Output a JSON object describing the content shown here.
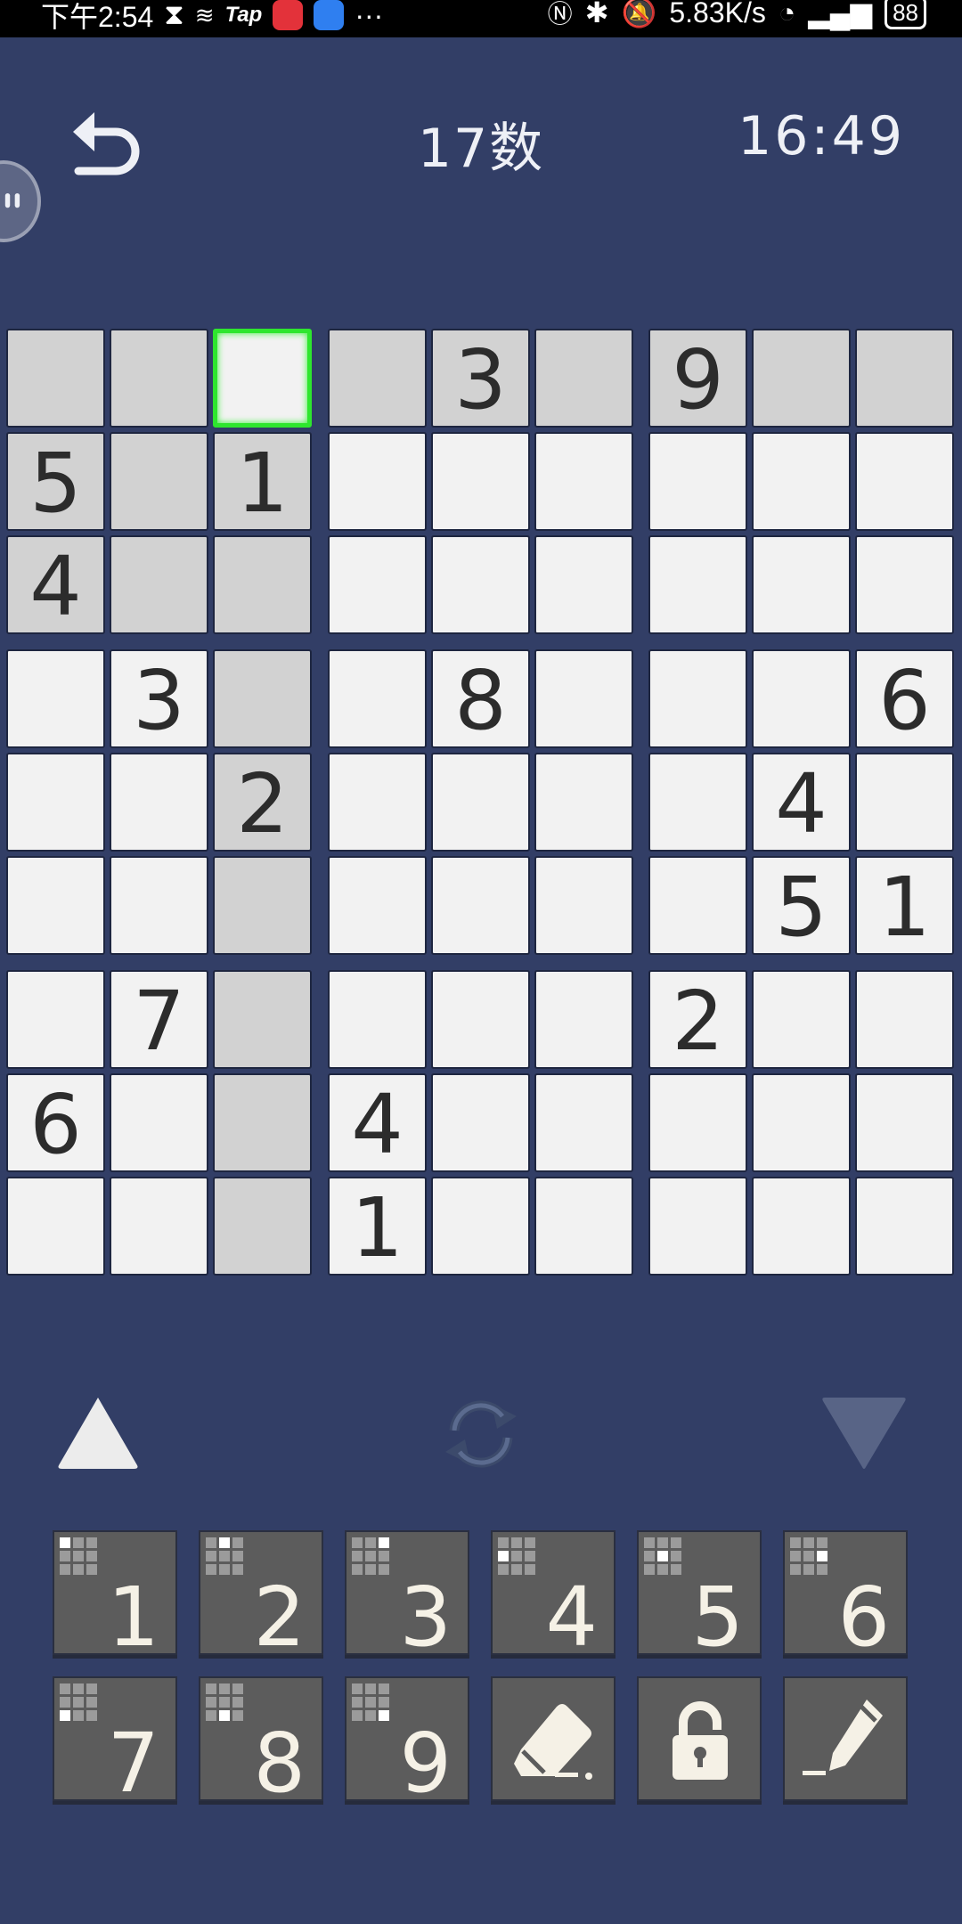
{
  "status_bar": {
    "time": "下午2:54",
    "network_speed": "5.83K/s",
    "battery": "88",
    "icons": [
      "hourglass-icon",
      "swirl-icon",
      "tap-icon",
      "huawei-app-icon",
      "cloud-icon",
      "more-icon",
      "nfc-icon",
      "bluetooth-icon",
      "mute-icon",
      "wifi-icon",
      "signal-icon",
      "battery-icon"
    ]
  },
  "header": {
    "title": "17数",
    "timer": "16:49",
    "back_icon": "back-arrow-icon"
  },
  "board": {
    "selected": [
      0,
      2
    ],
    "grid": [
      [
        "",
        "",
        "",
        "",
        "3",
        "",
        "9",
        "",
        ""
      ],
      [
        "5",
        "",
        "1",
        "",
        "",
        "",
        "",
        "",
        ""
      ],
      [
        "4",
        "",
        "",
        "",
        "",
        "",
        "",
        "",
        ""
      ],
      [
        "",
        "3",
        "",
        "",
        "8",
        "",
        "",
        "",
        "6"
      ],
      [
        "",
        "",
        "2",
        "",
        "",
        "",
        "",
        "4",
        ""
      ],
      [
        "",
        "",
        "",
        "",
        "",
        "",
        "",
        "5",
        "1"
      ],
      [
        "",
        "7",
        "",
        "",
        "",
        "",
        "2",
        "",
        ""
      ],
      [
        "6",
        "",
        "",
        "4",
        "",
        "",
        "",
        "",
        ""
      ],
      [
        "",
        "",
        "",
        "1",
        "",
        "",
        "",
        "",
        ""
      ]
    ]
  },
  "controls": {
    "up_icon": "triangle-up-icon",
    "refresh_icon": "refresh-icon",
    "down_icon": "triangle-down-icon"
  },
  "keypad": {
    "digits": [
      "1",
      "2",
      "3",
      "4",
      "5",
      "6",
      "7",
      "8",
      "9"
    ],
    "tools": [
      "eraser-icon",
      "lock-icon",
      "pencil-icon"
    ]
  },
  "colors": {
    "background": "#323e66",
    "cell": "#f2f2f2",
    "cell_highlight": "#d2d2d2",
    "selection": "#2ee62e",
    "key": "#5c5c5c"
  }
}
